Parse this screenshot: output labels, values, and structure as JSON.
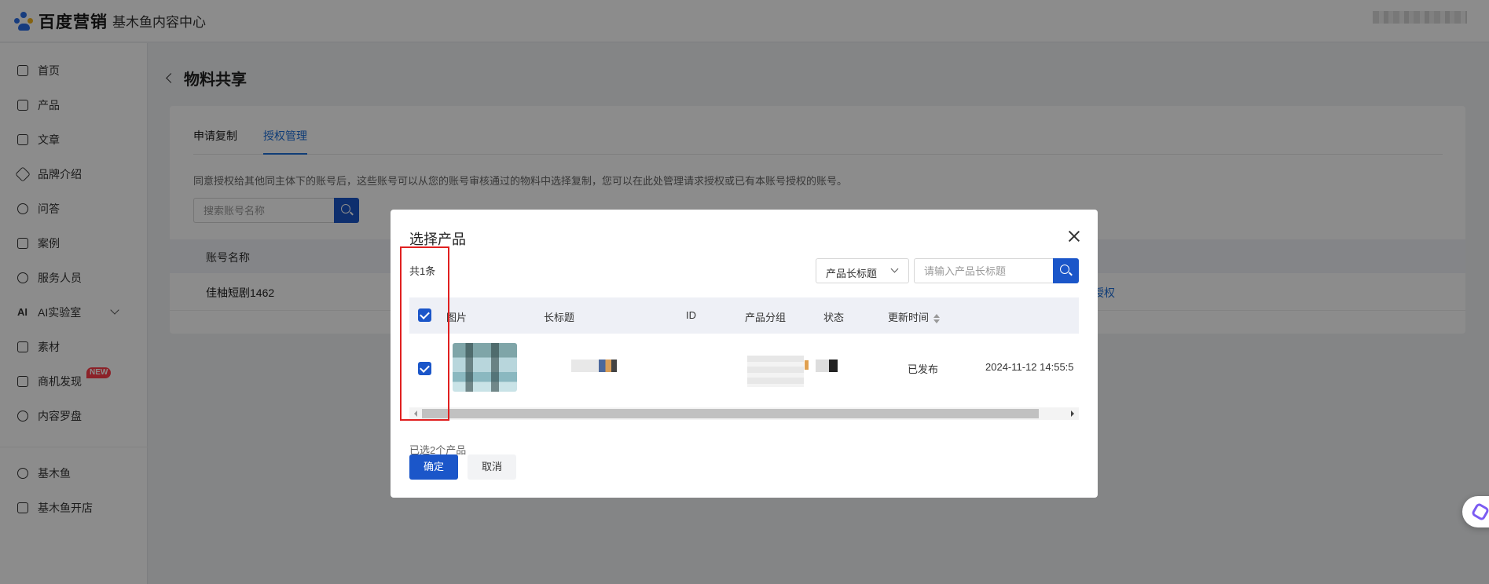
{
  "header": {
    "brand": "百度营销",
    "subtitle": "基木鱼内容中心"
  },
  "sidebar": {
    "items": [
      {
        "label": "首页",
        "icon": "home-icon"
      },
      {
        "label": "产品",
        "icon": "box-icon"
      },
      {
        "label": "文章",
        "icon": "document-icon"
      },
      {
        "label": "品牌介绍",
        "icon": "diamond-icon"
      },
      {
        "label": "问答",
        "icon": "question-icon"
      },
      {
        "label": "案例",
        "icon": "clipboard-icon"
      },
      {
        "label": "服务人员",
        "icon": "people-icon"
      },
      {
        "label": "AI实验室",
        "icon": "ai-icon"
      },
      {
        "label": "素材",
        "icon": "folder-icon"
      },
      {
        "label": "商机发现",
        "icon": "opportunity-icon",
        "badge": "NEW"
      },
      {
        "label": "内容罗盘",
        "icon": "compass-icon"
      },
      {
        "label": "基木鱼",
        "icon": "jimuyu-icon"
      },
      {
        "label": "基木鱼开店",
        "icon": "shop-icon"
      }
    ]
  },
  "page": {
    "title": "物料共享",
    "tabs": [
      "申请复制",
      "授权管理"
    ],
    "active_tab": "授权管理",
    "description": "同意授权给其他同主体下的账号后，这些账号可以从您的账号审核通过的物料中选择复制，您可以在此处管理请求授权或已有本账号授权的账号。",
    "search_placeholder": "搜索账号名称",
    "table": {
      "header": "账号名称",
      "rows": [
        {
          "name": "佳柚短剧1462",
          "action": "授权"
        }
      ]
    }
  },
  "modal": {
    "title": "选择产品",
    "count": "共1条",
    "filter_field": "产品长标题",
    "filter_placeholder": "请输入产品长标题",
    "columns": [
      "图片",
      "长标题",
      "ID",
      "产品分组",
      "状态",
      "更新时间"
    ],
    "rows": [
      {
        "status": "已发布",
        "updated": "2024-11-12 14:55:5"
      }
    ],
    "selected_note": "已选2个产品",
    "confirm_label": "确定",
    "cancel_label": "取消"
  },
  "colors": {
    "primary": "#1b56c9",
    "link": "#1e6fd9",
    "highlight": "#e02020",
    "badge": "#ff3d4a"
  }
}
